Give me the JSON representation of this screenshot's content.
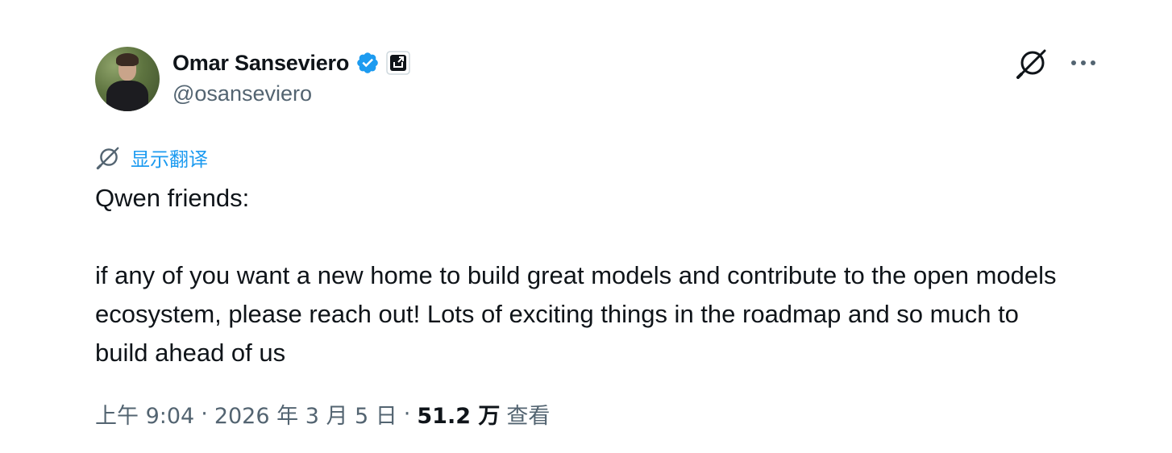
{
  "author": {
    "display_name": "Omar Sanseviero",
    "handle": "@osanseviero",
    "verified": true
  },
  "icons": {
    "verified": "verified-badge-icon",
    "affiliation": "affiliation-badge-icon",
    "grok": "grok-icon",
    "more": "more-options-icon",
    "translate": "translate-icon"
  },
  "colors": {
    "accent": "#1d9bf0",
    "text": "#0f1419",
    "secondary": "#536471"
  },
  "translate": {
    "label": "显示翻译"
  },
  "tweet": {
    "paragraphs": [
      "Qwen friends:",
      "if any of you want a new home to build great models and contribute to the open models ecosystem, please reach out! Lots of exciting things in the roadmap and so much to build ahead of us"
    ]
  },
  "meta": {
    "time": "上午 9:04",
    "date": "2026 年 3 月 5 日",
    "separator": "·",
    "views_count": "51.2 万",
    "views_label": "查看"
  }
}
